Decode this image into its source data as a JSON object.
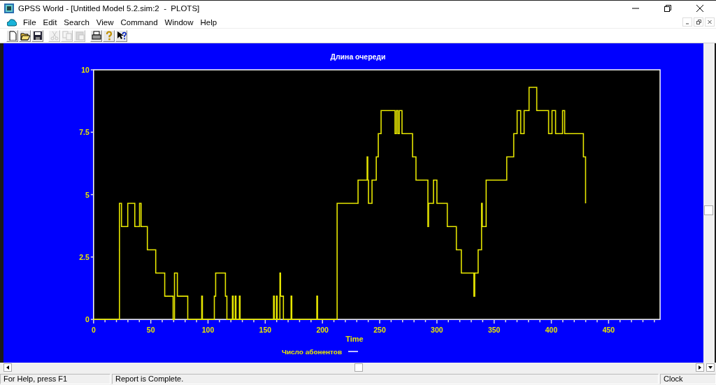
{
  "window": {
    "title": "GPSS World - [Untitled Model 5.2.sim:2  -  PLOTS]"
  },
  "menu": [
    "File",
    "Edit",
    "Search",
    "View",
    "Command",
    "Window",
    "Help"
  ],
  "toolbar": [
    {
      "kind": "new",
      "disabled": false
    },
    {
      "kind": "open",
      "disabled": false
    },
    {
      "kind": "save",
      "disabled": false
    },
    {
      "kind": "cut",
      "disabled": true
    },
    {
      "kind": "copy",
      "disabled": true
    },
    {
      "kind": "paste",
      "disabled": true
    },
    {
      "kind": "print",
      "disabled": false
    },
    {
      "kind": "help",
      "disabled": false
    },
    {
      "kind": "context-help",
      "disabled": false
    }
  ],
  "plot": {
    "chart_data": {
      "type": "line",
      "title": "Длина очереди",
      "xlabel": "Time",
      "xlim": [
        0,
        495
      ],
      "ylim": [
        0,
        10
      ],
      "xticks": [
        0,
        50,
        100,
        150,
        200,
        250,
        300,
        350,
        400,
        450
      ],
      "yticks": [
        0,
        2.5,
        5,
        7.5,
        10
      ],
      "x": [
        0,
        22.6,
        22.6,
        24.4,
        24.4,
        29.9,
        29.9,
        36.0,
        36.0,
        40.2,
        40.2,
        41.5,
        41.5,
        47.0,
        47.0,
        54.3,
        54.3,
        62.2,
        62.2,
        69.5,
        69.5,
        70.7,
        70.7,
        73.2,
        73.2,
        82.3,
        82.3,
        94.5,
        94.5,
        95.1,
        95.1,
        105.5,
        105.5,
        106.7,
        106.7,
        115.2,
        115.2,
        116.5,
        116.5,
        121.3,
        121.3,
        122.0,
        122.0,
        123.8,
        123.8,
        124.4,
        124.4,
        127.4,
        127.4,
        128.0,
        128.0,
        157.3,
        157.3,
        157.9,
        157.9,
        159.8,
        159.8,
        160.4,
        160.4,
        162.8,
        162.8,
        163.4,
        163.4,
        165.9,
        165.9,
        172.6,
        172.6,
        173.2,
        173.2,
        195.1,
        195.1,
        195.7,
        195.7,
        212.8,
        212.8,
        231.1,
        231.1,
        239.0,
        239.0,
        239.6,
        239.6,
        240.2,
        240.2,
        243.3,
        243.3,
        247.0,
        247.0,
        248.8,
        248.8,
        251.2,
        251.2,
        263.4,
        263.4,
        264.6,
        264.6,
        265.9,
        265.9,
        267.1,
        267.1,
        269.5,
        269.5,
        278.7,
        278.7,
        281.7,
        281.7,
        292.1,
        292.1,
        292.7,
        292.7,
        297.0,
        297.0,
        300.0,
        300.0,
        309.1,
        309.1,
        317.0,
        317.0,
        321.3,
        321.3,
        332.3,
        332.3,
        333.0,
        333.0,
        336.0,
        336.0,
        339.0,
        339.0,
        339.6,
        339.6,
        343.0,
        343.0,
        361.0,
        361.0,
        367.1,
        367.1,
        370.1,
        370.1,
        373.2,
        373.2,
        376.2,
        376.2,
        380.5,
        380.5,
        387.2,
        387.2,
        397.6,
        397.6,
        400.6,
        400.6,
        403.7,
        403.7,
        409.8,
        409.8,
        411.6,
        411.6,
        428.0,
        428.0,
        429.9,
        429.9
      ],
      "series": [
        {
          "name": "Число абонентов",
          "color": "#e6e600",
          "values": [
            0,
            0,
            4.65,
            4.65,
            3.72,
            3.72,
            4.65,
            4.65,
            3.72,
            3.72,
            4.65,
            4.65,
            3.72,
            3.72,
            2.79,
            2.79,
            1.86,
            1.86,
            0.93,
            0.93,
            0,
            0,
            1.86,
            1.86,
            0.93,
            0.93,
            0,
            0,
            0.93,
            0.93,
            0,
            0,
            0.93,
            0.93,
            1.86,
            1.86,
            0.93,
            0.93,
            0,
            0,
            0.93,
            0.93,
            0,
            0,
            0.93,
            0.93,
            0,
            0,
            0.93,
            0.93,
            0,
            0,
            0.93,
            0.93,
            0,
            0,
            0.93,
            0.93,
            0,
            0,
            1.86,
            1.86,
            0.93,
            0.93,
            0,
            0,
            0.93,
            0.93,
            0,
            0,
            0.93,
            0.93,
            0,
            0,
            4.65,
            4.65,
            5.58,
            5.58,
            6.51,
            6.51,
            5.58,
            5.58,
            4.65,
            4.65,
            5.58,
            5.58,
            6.51,
            6.51,
            7.44,
            7.44,
            8.37,
            8.37,
            7.44,
            7.44,
            8.37,
            8.37,
            7.44,
            7.44,
            8.37,
            8.37,
            7.44,
            7.44,
            6.51,
            6.51,
            5.58,
            5.58,
            3.72,
            3.72,
            4.65,
            4.65,
            5.58,
            5.58,
            4.65,
            4.65,
            3.72,
            3.72,
            2.79,
            2.79,
            1.86,
            1.86,
            0.93,
            0.93,
            1.86,
            1.86,
            2.79,
            2.79,
            4.65,
            4.65,
            3.72,
            3.72,
            5.58,
            5.58,
            6.51,
            6.51,
            7.44,
            7.44,
            8.37,
            8.37,
            7.44,
            7.44,
            8.37,
            8.37,
            9.3,
            9.3,
            8.37,
            8.37,
            7.44,
            7.44,
            8.37,
            8.37,
            7.44,
            7.44,
            8.37,
            8.37,
            7.44,
            7.44,
            6.51,
            6.51,
            4.65
          ]
        }
      ]
    }
  },
  "status_bar": [
    "For Help, press F1",
    "Report is Complete.",
    "Clock"
  ]
}
